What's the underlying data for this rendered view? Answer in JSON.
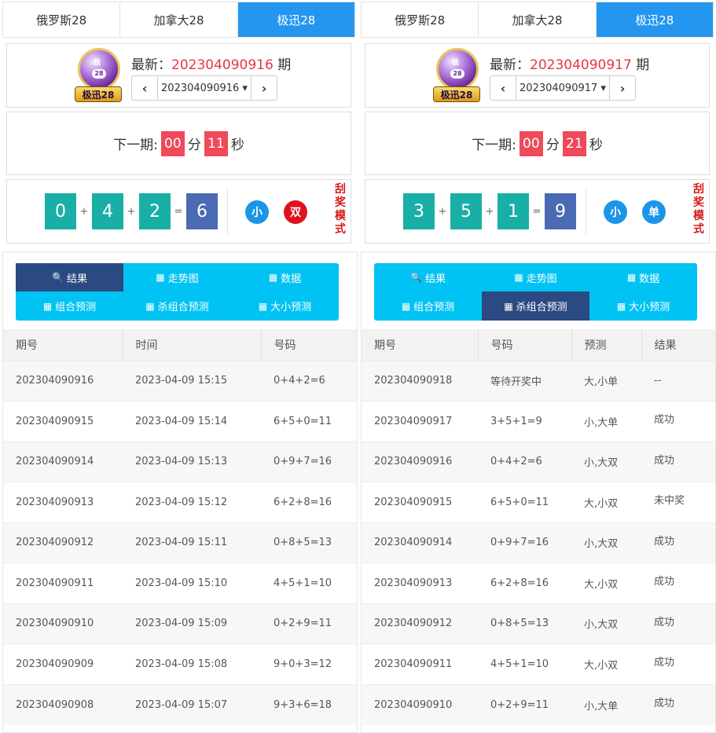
{
  "left": {
    "tabs": [
      "俄罗斯28",
      "加拿大28",
      "极迅28"
    ],
    "logo": {
      "ball_top": "极",
      "ball_num": "28",
      "label": "极迅28"
    },
    "latest": {
      "prefix": "最新：",
      "period": "202304090916",
      "suffix": " 期"
    },
    "select": {
      "value": "202304090916 ▾",
      "prev": "‹",
      "next": "›"
    },
    "countdown": {
      "label": "下一期:",
      "min": "00",
      "min_unit": "分",
      "sec": "11",
      "sec_unit": "秒"
    },
    "result": {
      "a": "0",
      "b": "4",
      "c": "2",
      "sum": "6",
      "plus": "+",
      "eq": "=",
      "size": "小",
      "parity": "双",
      "mode": [
        "刮",
        "奖",
        "模",
        "式"
      ]
    },
    "nav": [
      {
        "icon": "🔍",
        "label": "结果"
      },
      {
        "icon": "▦",
        "label": "走势图"
      },
      {
        "icon": "▦",
        "label": "数据"
      },
      {
        "icon": "▦",
        "label": "组合预测"
      },
      {
        "icon": "▦",
        "label": "杀组合预测"
      },
      {
        "icon": "▦",
        "label": "大小预测"
      }
    ],
    "headers": [
      "期号",
      "时间",
      "号码"
    ],
    "rows": [
      [
        "202304090916",
        "2023-04-09 15:15",
        "0+4+2=6"
      ],
      [
        "202304090915",
        "2023-04-09 15:14",
        "6+5+0=11"
      ],
      [
        "202304090914",
        "2023-04-09 15:13",
        "0+9+7=16"
      ],
      [
        "202304090913",
        "2023-04-09 15:12",
        "6+2+8=16"
      ],
      [
        "202304090912",
        "2023-04-09 15:11",
        "0+8+5=13"
      ],
      [
        "202304090911",
        "2023-04-09 15:10",
        "4+5+1=10"
      ],
      [
        "202304090910",
        "2023-04-09 15:09",
        "0+2+9=11"
      ],
      [
        "202304090909",
        "2023-04-09 15:08",
        "9+0+3=12"
      ],
      [
        "202304090908",
        "2023-04-09 15:07",
        "9+3+6=18"
      ]
    ]
  },
  "right": {
    "tabs": [
      "俄罗斯28",
      "加拿大28",
      "极迅28"
    ],
    "logo": {
      "ball_top": "极",
      "ball_num": "28",
      "label": "极迅28"
    },
    "latest": {
      "prefix": "最新：",
      "period": "202304090917",
      "suffix": " 期"
    },
    "select": {
      "value": "202304090917 ▾",
      "prev": "‹",
      "next": "›"
    },
    "countdown": {
      "label": "下一期:",
      "min": "00",
      "min_unit": "分",
      "sec": "21",
      "sec_unit": "秒"
    },
    "result": {
      "a": "3",
      "b": "5",
      "c": "1",
      "sum": "9",
      "plus": "+",
      "eq": "=",
      "size": "小",
      "parity": "单",
      "mode": [
        "刮",
        "奖",
        "模",
        "式"
      ]
    },
    "nav": [
      {
        "icon": "🔍",
        "label": "结果"
      },
      {
        "icon": "▦",
        "label": "走势图"
      },
      {
        "icon": "▦",
        "label": "数据"
      },
      {
        "icon": "▦",
        "label": "组合预测"
      },
      {
        "icon": "▦",
        "label": "杀组合预测"
      },
      {
        "icon": "▦",
        "label": "大小预测"
      }
    ],
    "headers": [
      "期号",
      "号码",
      "预测",
      "结果"
    ],
    "rows": [
      [
        "202304090918",
        "等待开奖中",
        "大,小单",
        "--"
      ],
      [
        "202304090917",
        "3+5+1=9",
        "小,大单",
        "成功"
      ],
      [
        "202304090916",
        "0+4+2=6",
        "小,大双",
        "成功"
      ],
      [
        "202304090915",
        "6+5+0=11",
        "大,小双",
        "未中奖"
      ],
      [
        "202304090914",
        "0+9+7=16",
        "小,大双",
        "成功"
      ],
      [
        "202304090913",
        "6+2+8=16",
        "大,小双",
        "成功"
      ],
      [
        "202304090912",
        "0+8+5=13",
        "小,大双",
        "成功"
      ],
      [
        "202304090911",
        "4+5+1=10",
        "大,小双",
        "成功"
      ],
      [
        "202304090910",
        "0+2+9=11",
        "小,大单",
        "成功"
      ]
    ]
  },
  "colors": {
    "tab_active": "#2496f0",
    "ball": "#1aafa6",
    "sum_ball": "#4a6ab4",
    "countdown": "#ef4a5a",
    "nav": "#00c3f3",
    "nav_active": "#2c4a82",
    "success": "#d01c1c"
  }
}
